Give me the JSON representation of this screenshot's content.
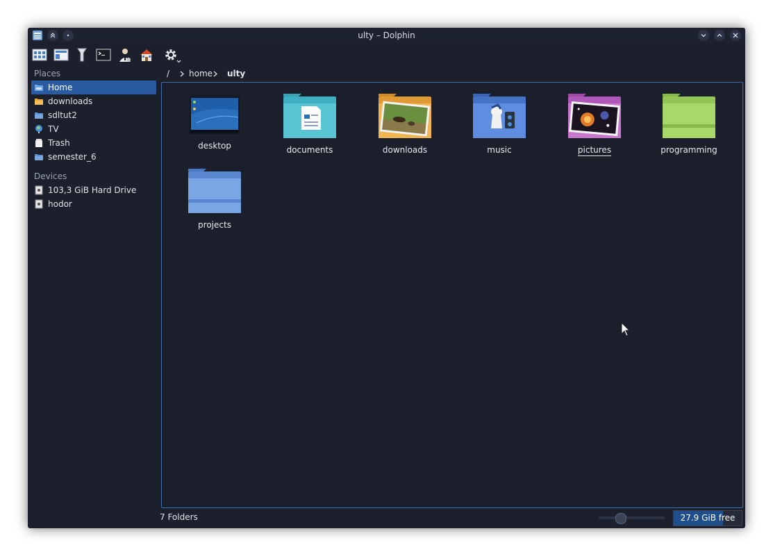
{
  "window": {
    "title": "ulty – Dolphin"
  },
  "sidebar": {
    "places_title": "Places",
    "places": [
      {
        "label": "Home",
        "icon": "home-folder-icon",
        "selected": true
      },
      {
        "label": "downloads",
        "icon": "folder-downloads-icon"
      },
      {
        "label": "sdltut2",
        "icon": "folder-icon"
      },
      {
        "label": "TV",
        "icon": "network-globe-icon"
      },
      {
        "label": "Trash",
        "icon": "trash-icon"
      },
      {
        "label": "semester_6",
        "icon": "folder-icon"
      }
    ],
    "devices_title": "Devices",
    "devices": [
      {
        "label": "103,3 GiB Hard Drive",
        "icon": "hard-drive-icon"
      },
      {
        "label": "hodor",
        "icon": "hard-drive-icon"
      }
    ]
  },
  "breadcrumb": {
    "root": "/",
    "home": "home",
    "current": "ulty"
  },
  "items": [
    {
      "label": "desktop",
      "icon": "desktop-folder-icon"
    },
    {
      "label": "documents",
      "icon": "documents-folder-icon"
    },
    {
      "label": "downloads",
      "icon": "downloads-folder-icon"
    },
    {
      "label": "music",
      "icon": "music-folder-icon"
    },
    {
      "label": "pictures",
      "icon": "pictures-folder-icon"
    },
    {
      "label": "programming",
      "icon": "programming-folder-icon"
    },
    {
      "label": "projects",
      "icon": "projects-folder-icon"
    }
  ],
  "status": {
    "folder_count": "7 Folders",
    "free_space": "27.9 GiB free",
    "free_fraction": 0.72
  },
  "colors": {
    "accent": "#2a5aa0",
    "background": "#1b202c",
    "view_border": "#3a6fb0"
  }
}
